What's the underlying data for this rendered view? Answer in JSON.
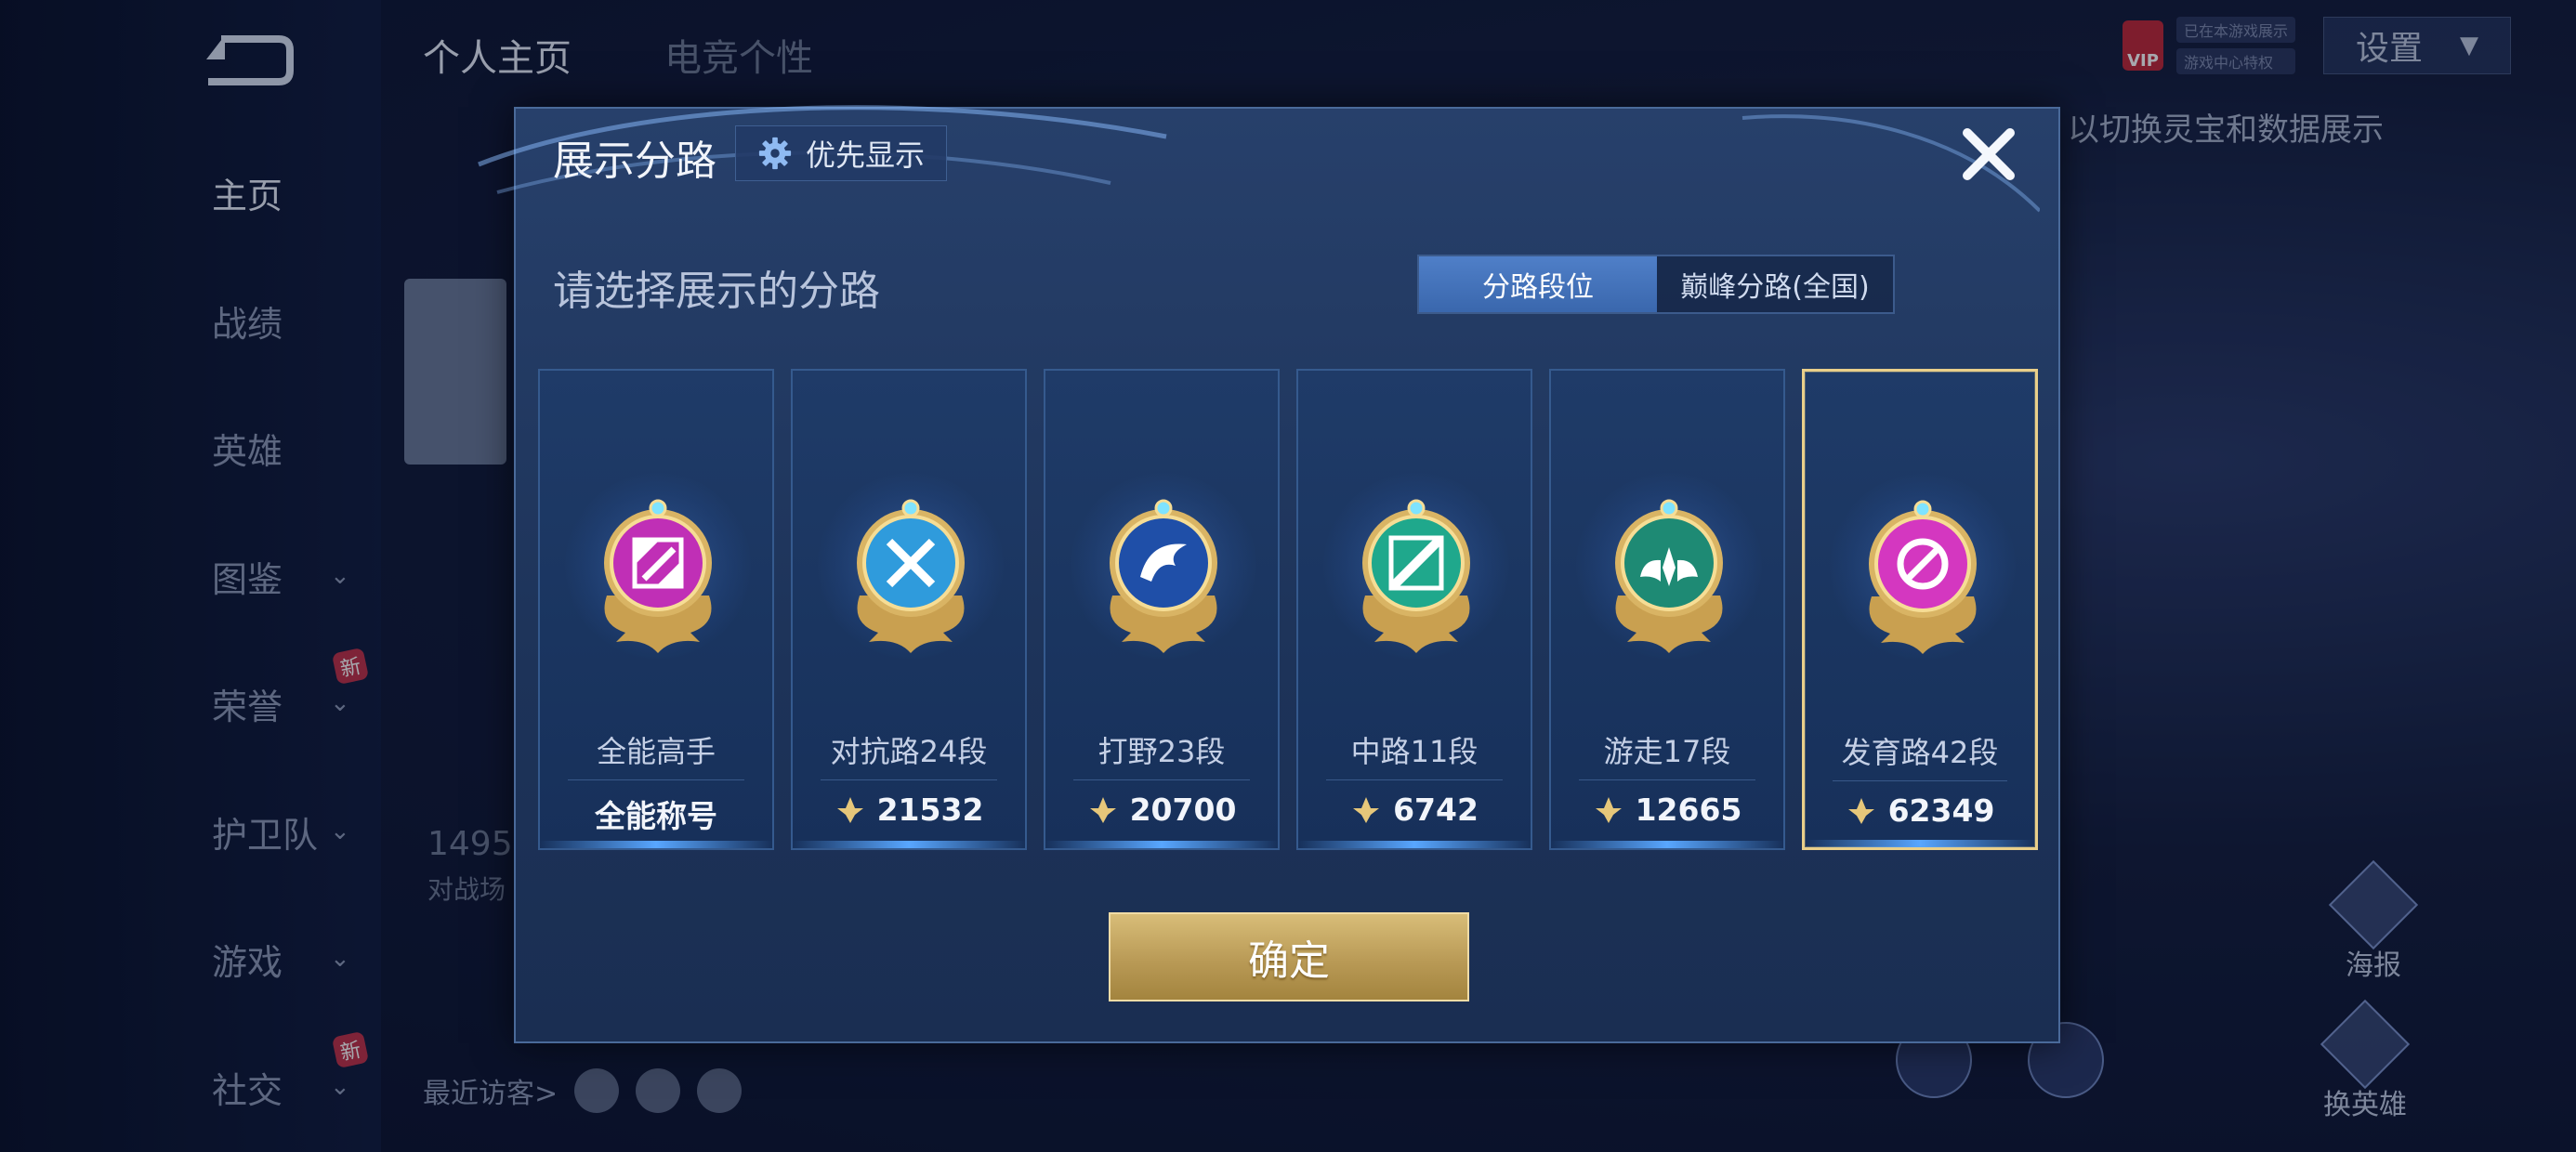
{
  "background": {
    "sidebar": [
      {
        "label": "主页",
        "active": true,
        "chevron": false
      },
      {
        "label": "战绩",
        "chevron": false
      },
      {
        "label": "英雄",
        "chevron": false
      },
      {
        "label": "图鉴",
        "chevron": true
      },
      {
        "label": "荣誉",
        "chevron": true,
        "badge": "新"
      },
      {
        "label": "护卫队",
        "chevron": true
      },
      {
        "label": "游戏",
        "chevron": true
      },
      {
        "label": "社交",
        "chevron": true,
        "badge": "新"
      }
    ],
    "tabs": [
      "个人主页",
      "电竞个性"
    ],
    "settings_label": "设置",
    "vip_label": "VIP",
    "vip_lines": [
      "已在本游戏展示",
      "游戏中心特权"
    ],
    "hint_text": "以切换灵宝和数据展示",
    "stat_number": "1495",
    "stat_label": "对战场",
    "recent_visitors_label": "最近访客>",
    "right_actions": [
      "海报",
      "换英雄"
    ]
  },
  "modal": {
    "title": "展示分路",
    "priority_button": "优先显示",
    "prompt": "请选择展示的分路",
    "segments": {
      "active": "分路段位",
      "other": "巅峰分路(全国)"
    },
    "cards": [
      {
        "lane": "全能高手",
        "score": "全能称号",
        "score_icon": false,
        "badge_color": "#c02fb6",
        "badge_icon": "all-round-icon",
        "selected": false
      },
      {
        "lane": "对抗路24段",
        "score": "21532",
        "score_icon": true,
        "badge_color": "#2f9bdc",
        "badge_icon": "crossed-swords-icon",
        "selected": false
      },
      {
        "lane": "打野23段",
        "score": "20700",
        "score_icon": true,
        "badge_color": "#1f4fa8",
        "badge_icon": "dragon-icon",
        "selected": false
      },
      {
        "lane": "中路11段",
        "score": "6742",
        "score_icon": true,
        "badge_color": "#1fa88c",
        "badge_icon": "mid-lane-icon",
        "selected": false
      },
      {
        "lane": "游走17段",
        "score": "12665",
        "score_icon": true,
        "badge_color": "#1e8a74",
        "badge_icon": "wings-icon",
        "selected": false
      },
      {
        "lane": "发育路42段",
        "score": "62349",
        "score_icon": true,
        "badge_color": "#d437c0",
        "badge_icon": "marksman-icon",
        "selected": true
      }
    ],
    "confirm_label": "确定"
  }
}
